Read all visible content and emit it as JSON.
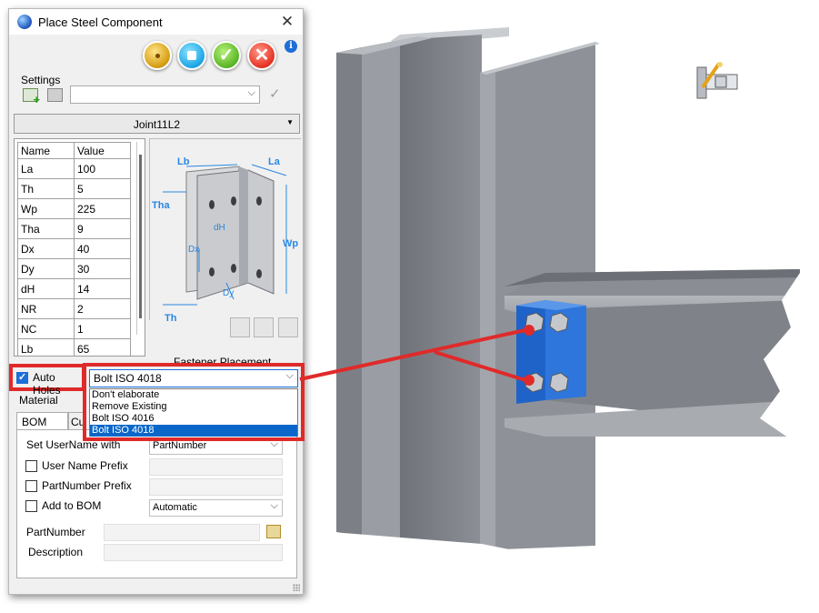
{
  "dialog": {
    "title": "Place Steel Component",
    "close_glyph": "✕",
    "toolbar": {
      "place_icon": "place-component-icon",
      "select_icon": "select-element-icon",
      "ok_glyph": "✓",
      "cancel_glyph": "✕",
      "info_glyph": "i"
    },
    "settings": {
      "label": "Settings",
      "combo_value": "",
      "apply_glyph": "✓"
    },
    "joint": {
      "value": "Joint11L2"
    },
    "grid": {
      "headers": {
        "name": "Name",
        "value": "Value"
      },
      "rows": [
        {
          "name": "La",
          "value": "100"
        },
        {
          "name": "Th",
          "value": "5"
        },
        {
          "name": "Wp",
          "value": "225"
        },
        {
          "name": "Tha",
          "value": "9"
        },
        {
          "name": "Dx",
          "value": "40"
        },
        {
          "name": "Dy",
          "value": "30"
        },
        {
          "name": "dH",
          "value": "14"
        },
        {
          "name": "NR",
          "value": "2"
        },
        {
          "name": "NC",
          "value": "1"
        },
        {
          "name": "Lb",
          "value": "65"
        }
      ]
    },
    "diagram_labels": {
      "lb": "Lb",
      "la": "La",
      "tha": "Tha",
      "dh": "dH",
      "wp": "Wp",
      "dx": "Dx",
      "dy": "Dy",
      "th": "Th"
    },
    "fastener": {
      "label": "Fastener Placement",
      "auto_holes_label": "Auto Holes",
      "auto_holes_checked": true,
      "selected": "Bolt ISO 4018",
      "options": [
        "Don't elaborate",
        "Remove Existing",
        "Bolt ISO 4016",
        "Bolt ISO 4018"
      ],
      "selected_index": 3
    },
    "material_label": "Material",
    "tabs": [
      "BOM Info",
      "Cu"
    ],
    "bom": {
      "set_username_label": "Set UserName with",
      "set_username_value": "PartNumber",
      "username_prefix_label": "User Name Prefix",
      "partnumber_prefix_label": "PartNumber Prefix",
      "add_to_bom_label": "Add to BOM",
      "add_to_bom_value": "Automatic",
      "partnumber_label": "PartNumber",
      "description_label": "Description"
    }
  },
  "colors": {
    "highlight_red": "#e02a2a",
    "steel": "#8e9298",
    "plate_blue": "#1f63c8",
    "dim_blue": "#2a87e0"
  }
}
